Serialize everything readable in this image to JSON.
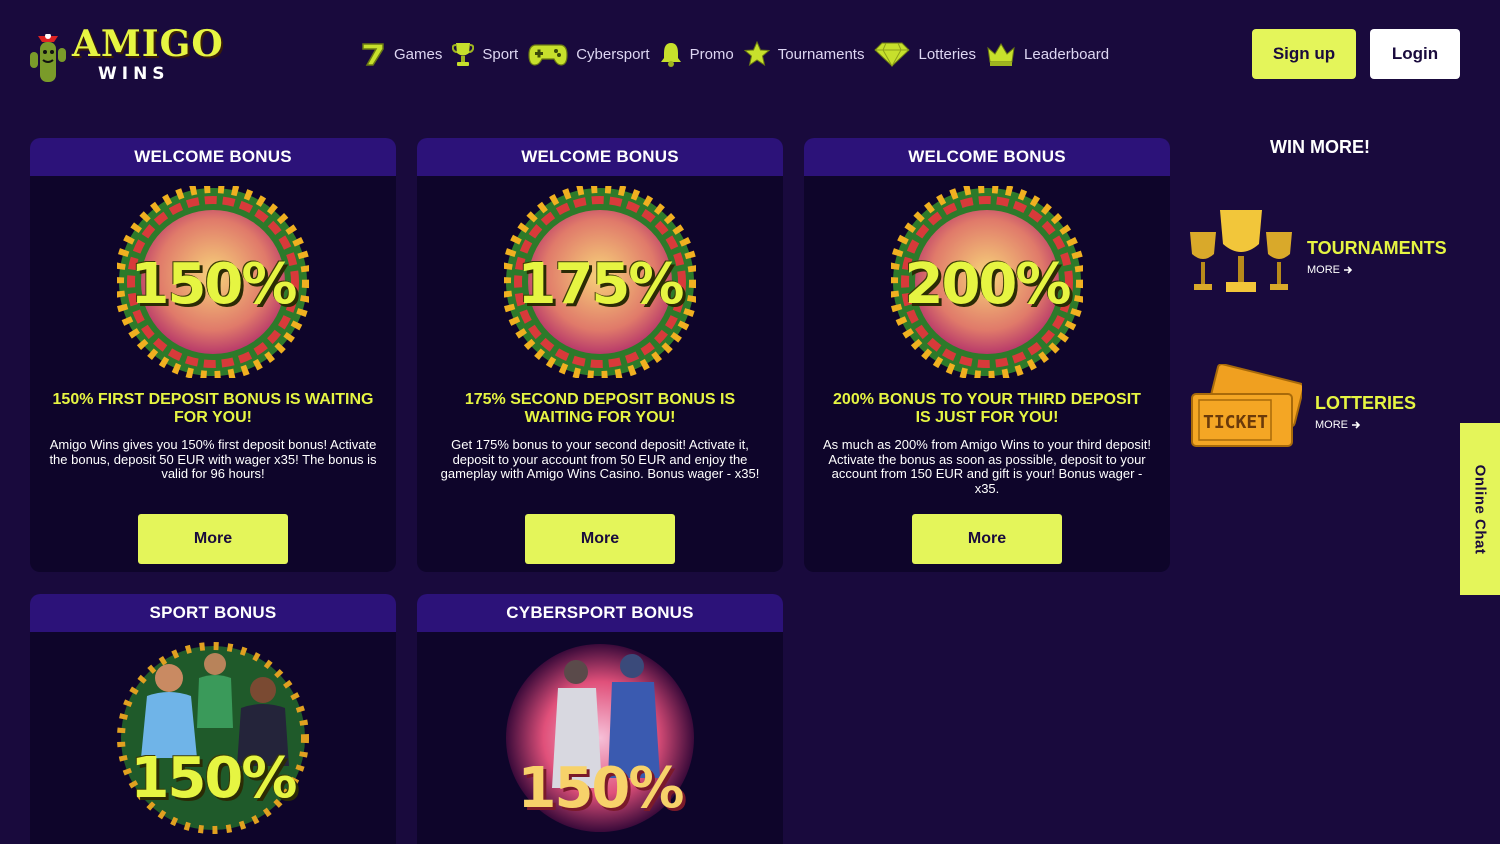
{
  "brand": {
    "name": "AMIGO",
    "sub": "WINS"
  },
  "nav": [
    {
      "label": "Games",
      "icon": "seven-icon"
    },
    {
      "label": "Sport",
      "icon": "trophy-icon"
    },
    {
      "label": "Cybersport",
      "icon": "gamepad-icon"
    },
    {
      "label": "Promo",
      "icon": "bell-icon"
    },
    {
      "label": "Tournaments",
      "icon": "star-icon"
    },
    {
      "label": "Lotteries",
      "icon": "diamond-icon"
    },
    {
      "label": "Leaderboard",
      "icon": "crown-icon"
    }
  ],
  "auth": {
    "signup": "Sign up",
    "login": "Login"
  },
  "cards": [
    {
      "header": "WELCOME BONUS",
      "percent": "150%",
      "title": "150% FIRST DEPOSIT BONUS IS WAITING FOR YOU!",
      "description": "Amigo Wins gives you 150% first deposit bonus! Activate the bonus, deposit 50 EUR with wager x35! The bonus is valid for 96 hours!",
      "button": "More"
    },
    {
      "header": "WELCOME BONUS",
      "percent": "175%",
      "title": "175% SECOND DEPOSIT BONUS IS WAITING FOR YOU!",
      "description": "Get 175% bonus to your second deposit! Activate it, deposit to your account from 50 EUR and enjoy the gameplay with Amigo Wins Casino. Bonus wager - x35!",
      "button": "More"
    },
    {
      "header": "WELCOME BONUS",
      "percent": "200%",
      "title": "200% BONUS TO YOUR THIRD DEPOSIT IS JUST FOR YOU!",
      "description": "As much as 200% from Amigo Wins to your third deposit! Activate the bonus as soon as possible, deposit to your account from 150 EUR and gift is your! Bonus wager - x35.",
      "button": "More"
    },
    {
      "header": "SPORT BONUS",
      "percent": "150%"
    },
    {
      "header": "CYBERSPORT BONUS",
      "percent": "150%"
    }
  ],
  "sidebar": {
    "heading": "WIN MORE!",
    "items": [
      {
        "title": "TOURNAMENTS",
        "more": "MORE"
      },
      {
        "title": "LOTTERIES",
        "more": "MORE",
        "ticket_text": "TICKET"
      }
    ]
  },
  "chat": {
    "label": "Online Chat"
  },
  "colors": {
    "background": "#190a3d",
    "accent": "#e4f55a",
    "card_header": "#2c1279",
    "card_body": "#0e052a"
  }
}
